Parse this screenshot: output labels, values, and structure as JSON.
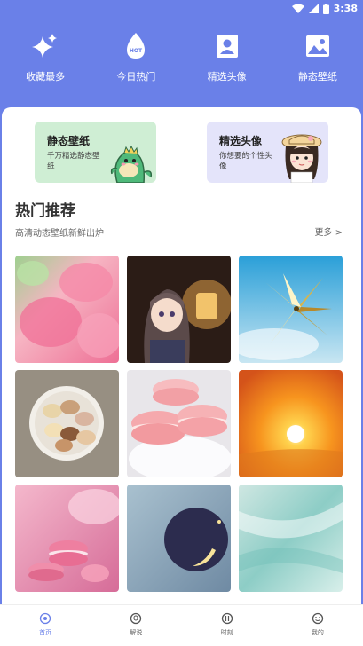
{
  "status_bar": {
    "time": "3:38"
  },
  "top_nav": [
    {
      "label": "收藏最多",
      "icon": "sparkle-icon"
    },
    {
      "label": "今日热门",
      "icon": "hot-icon",
      "badge": "HOT"
    },
    {
      "label": "精选头像",
      "icon": "avatar-icon"
    },
    {
      "label": "静态壁纸",
      "icon": "image-icon"
    }
  ],
  "promos": [
    {
      "title": "静态壁纸",
      "desc": "千万精选静态壁纸"
    },
    {
      "title": "精选头像",
      "desc": "你想要的个性头像"
    }
  ],
  "section": {
    "title": "热门推荐",
    "subtitle": "高清动态壁纸新鲜出炉",
    "more": "更多 >"
  },
  "wallpapers": [
    {
      "name": "pink-flowers"
    },
    {
      "name": "anime-girl-lantern"
    },
    {
      "name": "pinwheel-sky"
    },
    {
      "name": "macarons-bowl"
    },
    {
      "name": "pink-macarons"
    },
    {
      "name": "sunset-sun"
    },
    {
      "name": "pink-macaron-flowers"
    },
    {
      "name": "crescent-moon"
    },
    {
      "name": "teal-abstract"
    }
  ],
  "bottom_nav": [
    {
      "label": "首页",
      "icon": "home-icon",
      "active": true
    },
    {
      "label": "解说",
      "icon": "commentary-icon",
      "active": false
    },
    {
      "label": "时刻",
      "icon": "clock-icon",
      "active": false
    },
    {
      "label": "我的",
      "icon": "profile-icon",
      "active": false
    }
  ],
  "colors": {
    "accent": "#6a80e8",
    "promo_green": "#cfeed4",
    "promo_purple": "#e4e4fa"
  }
}
